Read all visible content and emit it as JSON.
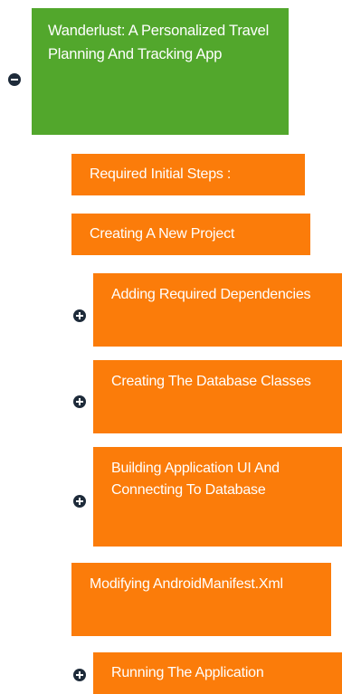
{
  "root": {
    "label": "Wanderlust: A Personalized Travel Planning And Tracking App",
    "state": "expanded"
  },
  "nodes": [
    {
      "label": "Required Initial Steps :",
      "has_children": false
    },
    {
      "label": "Creating A New Project",
      "has_children": false
    },
    {
      "label": "Adding Required Dependencies",
      "has_children": true
    },
    {
      "label": "Creating The Database Classes",
      "has_children": true
    },
    {
      "label": "Building Application UI And Connecting To Database",
      "has_children": true
    },
    {
      "label": "Modifying AndroidManifest.Xml",
      "has_children": false
    },
    {
      "label": "Running The Application",
      "has_children": true
    }
  ],
  "colors": {
    "root_bg": "#52a72c",
    "child_bg": "#fb7c0a",
    "toggle": "#1e2b3a",
    "text": "#ffffff"
  },
  "icons": {
    "collapse": "minus-circle-icon",
    "expand": "plus-circle-icon"
  }
}
